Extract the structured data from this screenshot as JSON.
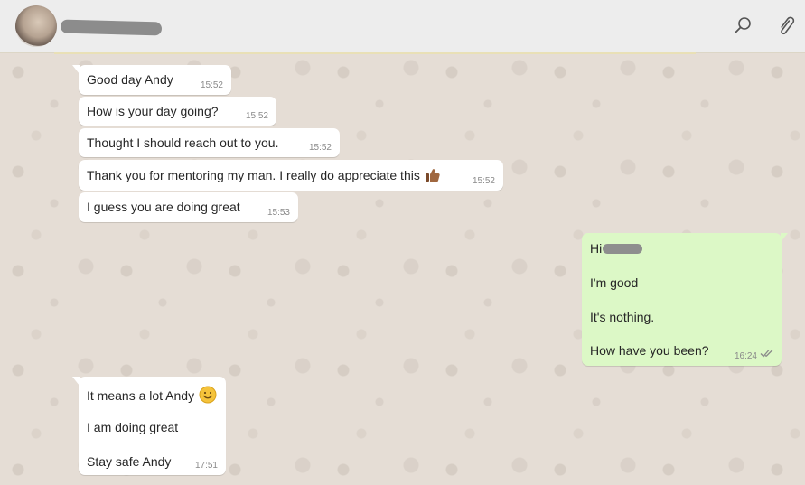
{
  "header": {
    "contact_name": "",
    "icons": {
      "search": "search-icon",
      "attach": "paperclip-icon"
    }
  },
  "colors": {
    "incoming_bubble": "#ffffff",
    "outgoing_bubble": "#dcf8c6",
    "wallpaper": "#e5ddd5",
    "header": "#ededed",
    "read_ticks": "#8a8a8a"
  },
  "messages": [
    {
      "direction": "in",
      "lines": [
        "Good day Andy"
      ],
      "time": "15:52"
    },
    {
      "direction": "in",
      "lines": [
        "How is your day going?"
      ],
      "time": "15:52"
    },
    {
      "direction": "in",
      "lines": [
        "Thought I should reach out to you."
      ],
      "time": "15:52"
    },
    {
      "direction": "in",
      "lines": [
        "Thank you for mentoring my man. I really do appreciate this"
      ],
      "emoji": "thumbs-up-icon",
      "time": "15:52"
    },
    {
      "direction": "in",
      "lines": [
        "I guess you are doing great"
      ],
      "time": "15:53"
    },
    {
      "direction": "out",
      "lines": [
        "Hi",
        "I'm good",
        "It's nothing.",
        "How have you been?"
      ],
      "time": "16:24",
      "status": "read"
    },
    {
      "direction": "in",
      "lines": [
        "It means a lot Andy",
        "I am doing great",
        "Stay safe Andy"
      ],
      "emoji": "smiling-face-icon",
      "time": "17:51"
    }
  ]
}
